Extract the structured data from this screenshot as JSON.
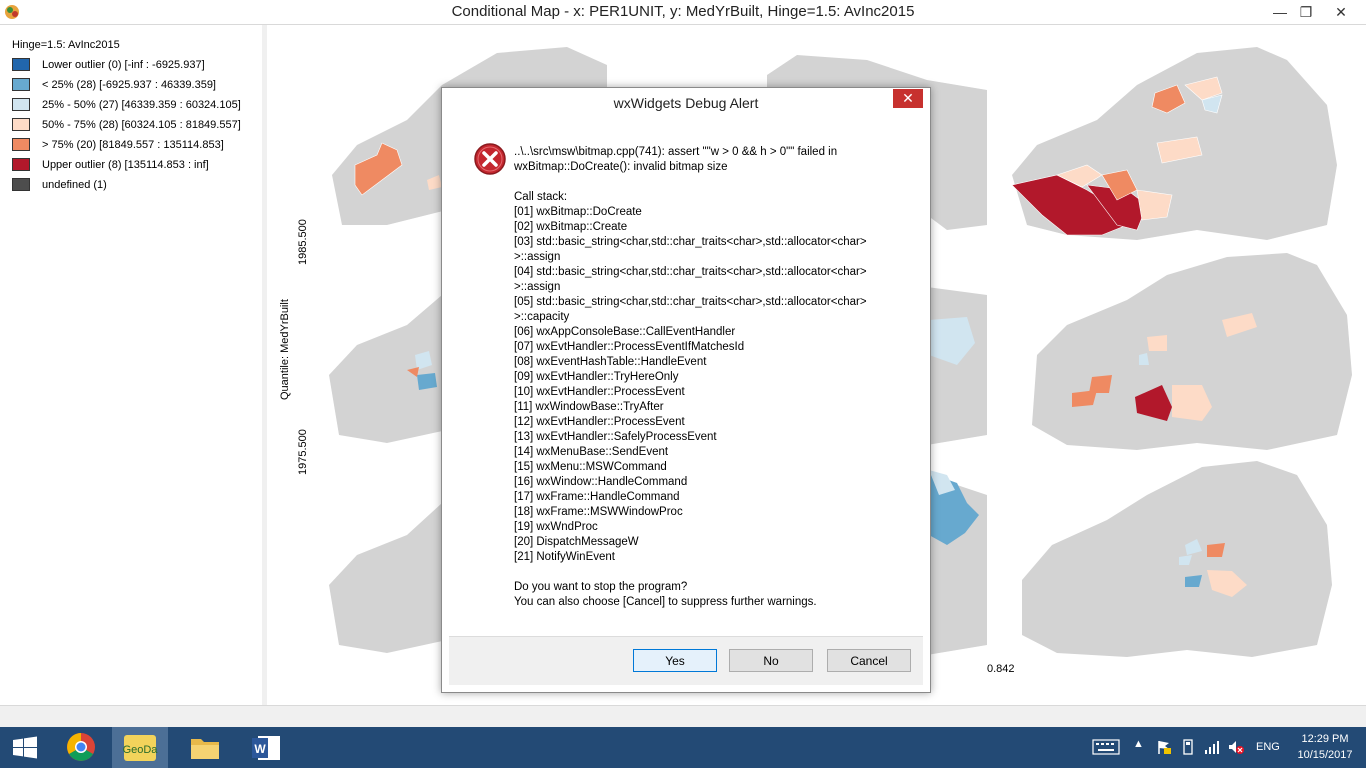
{
  "window": {
    "title": "Conditional Map - x: PER1UNIT, y: MedYrBuilt, Hinge=1.5: AvInc2015",
    "minimize": "—",
    "maximize": "❐",
    "close": "✕"
  },
  "legend": {
    "title": "Hinge=1.5: AvInc2015",
    "items": [
      {
        "label": "Lower outlier (0)  [-inf : -6925.937]",
        "color": "#2166ac"
      },
      {
        "label": "< 25% (28)  [-6925.937 : 46339.359]",
        "color": "#67a9cf"
      },
      {
        "label": "25% - 50% (27)  [46339.359 : 60324.105]",
        "color": "#d1e5f0"
      },
      {
        "label": "50% - 75% (28)  [60324.105 : 81849.557]",
        "color": "#fddbc7"
      },
      {
        "label": "> 75% (20)  [81849.557 : 135114.853]",
        "color": "#ef8a62"
      },
      {
        "label": "Upper outlier (8)  [135114.853 : inf]",
        "color": "#b2182b"
      },
      {
        "label": "undefined (1)",
        "color": "#4d4d4d"
      }
    ]
  },
  "map": {
    "y_axis_label": "Quantile: MedYrBuilt",
    "y_breaks": [
      "1985.500",
      "1975.500"
    ],
    "x_break_right": "0.842"
  },
  "dialog": {
    "title": "wxWidgets Debug Alert",
    "close": "✕",
    "assert_lines": [
      "..\\..\\src\\msw\\bitmap.cpp(741): assert \"\"w > 0 && h > 0\"\" failed in",
      "wxBitmap::DoCreate(): invalid bitmap size"
    ],
    "call_stack_header": "Call stack:",
    "call_stack": [
      "[01] wxBitmap::DoCreate",
      "[02] wxBitmap::Create",
      "[03] std::basic_string<char,std::char_traits<char>,std::allocator<char>",
      ">::assign",
      "[04] std::basic_string<char,std::char_traits<char>,std::allocator<char>",
      ">::assign",
      "[05] std::basic_string<char,std::char_traits<char>,std::allocator<char>",
      ">::capacity",
      "[06] wxAppConsoleBase::CallEventHandler",
      "[07] wxEvtHandler::ProcessEventIfMatchesId",
      "[08] wxEventHashTable::HandleEvent",
      "[09] wxEvtHandler::TryHereOnly",
      "[10] wxEvtHandler::ProcessEvent",
      "[11] wxWindowBase::TryAfter",
      "[12] wxEvtHandler::ProcessEvent",
      "[13] wxEvtHandler::SafelyProcessEvent",
      "[14] wxMenuBase::SendEvent",
      "[15] wxMenu::MSWCommand",
      "[16] wxWindow::HandleCommand",
      "[17] wxFrame::HandleCommand",
      "[18] wxFrame::MSWWindowProc",
      "[19] wxWndProc",
      "[20] DispatchMessageW",
      "[21] NotifyWinEvent"
    ],
    "question": "Do you want to stop the program?",
    "hint": "You can also choose [Cancel] to suppress further warnings.",
    "buttons": {
      "yes": "Yes",
      "no": "No",
      "cancel": "Cancel"
    }
  },
  "taskbar": {
    "lang": "ENG",
    "time": "12:29 PM",
    "date": "10/15/2017",
    "apps": [
      "start-icon",
      "chrome-icon",
      "geoda-icon",
      "file-explorer-icon",
      "word-icon"
    ]
  }
}
